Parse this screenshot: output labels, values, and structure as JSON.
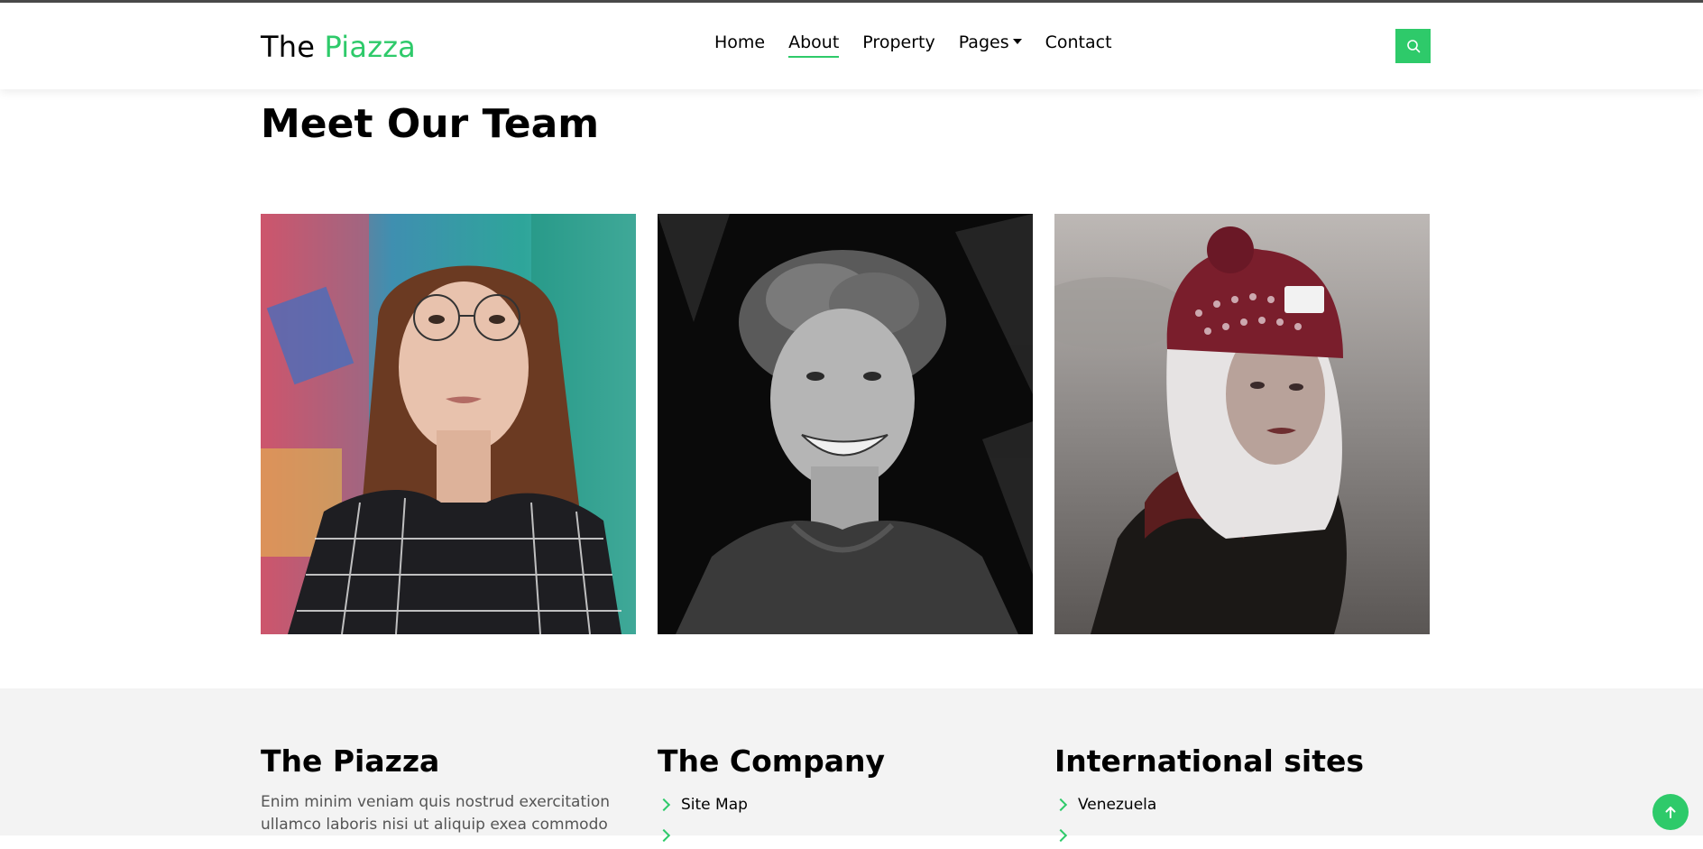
{
  "header": {
    "logo_primary": "The",
    "logo_accent": "Piazza",
    "nav": [
      {
        "label": "Home"
      },
      {
        "label": "About"
      },
      {
        "label": "Property"
      },
      {
        "label": "Pages"
      },
      {
        "label": "Contact"
      }
    ],
    "search_icon": "search-icon"
  },
  "team": {
    "title": "Meet Our Team"
  },
  "footer": {
    "col1": {
      "title": "The Piazza",
      "text": "Enim minim veniam quis nostrud exercitation ullamco laboris nisi ut aliquip exea commodo"
    },
    "col2": {
      "title": "The Company",
      "items": [
        "Site Map"
      ]
    },
    "col3": {
      "title": "International sites",
      "items": [
        "Venezuela"
      ]
    }
  },
  "colors": {
    "accent": "#2eca6a"
  },
  "back_to_top_icon": "arrow-up-icon"
}
